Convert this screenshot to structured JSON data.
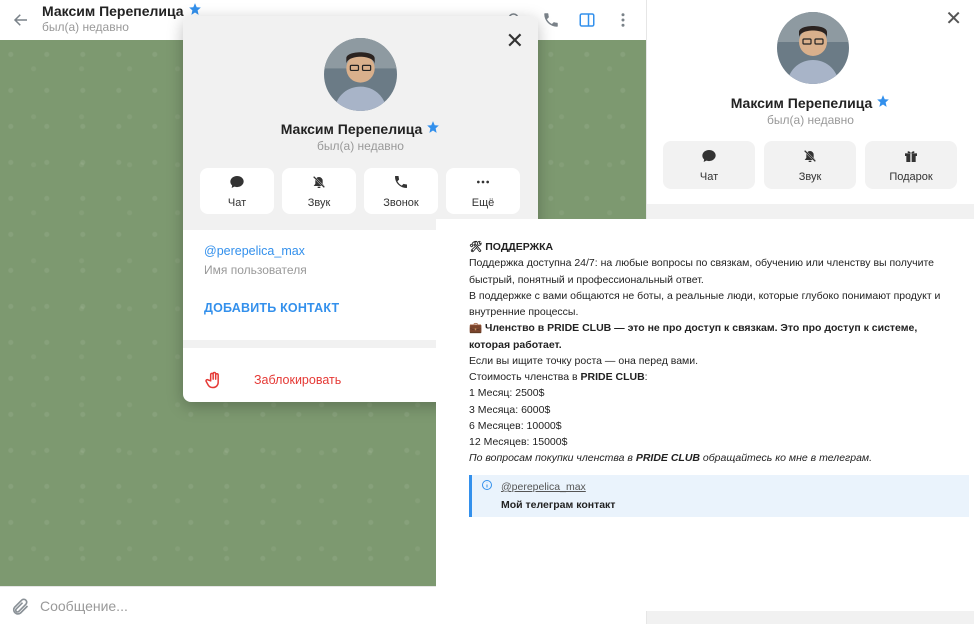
{
  "header": {
    "title": "Максим Перепелица",
    "status": "был(а) недавно"
  },
  "composer": {
    "placeholder": "Сообщение..."
  },
  "popup": {
    "name": "Максим Перепелица",
    "status": "был(а) недавно",
    "actions": [
      {
        "label": "Чат",
        "icon": "chat-icon"
      },
      {
        "label": "Звук",
        "icon": "mute-icon"
      },
      {
        "label": "Звонок",
        "icon": "phone-icon"
      },
      {
        "label": "Ещё",
        "icon": "more-icon"
      }
    ],
    "username": "@perepelica_max",
    "username_caption": "Имя пользователя",
    "add_contact": "ДОБАВИТЬ КОНТАКТ",
    "block": "Заблокировать"
  },
  "right_panel": {
    "name": "Максим Перепелица",
    "status": "был(а) недавно",
    "actions": [
      {
        "label": "Чат",
        "icon": "chat-icon"
      },
      {
        "label": "Звук",
        "icon": "mute-icon"
      },
      {
        "label": "Подарок",
        "icon": "gift-icon"
      }
    ]
  },
  "message": {
    "support_title": "🛠 ПОДДЕРЖКА",
    "support_p1": "Поддержка доступна 24/7: на любые вопросы по связкам, обучению или членству вы получите быстрый, понятный и профессиональный ответ.",
    "support_p2": "В поддержке с вами общаются не боты, а реальные люди, которые глубоко понимают продукт и внутренние процессы.",
    "membership_title": "💼 Членство в PRIDE CLUB — это не про доступ к связкам. Это про доступ к системе, которая работает.",
    "growth": "Если вы ищите точку роста — она перед вами.",
    "cost_label": "Стоимость членства в ",
    "cost_label_bold": "PRIDE CLUB",
    "cost_label_end": ":",
    "prices": [
      "1 Месяц: 2500$",
      "3 Месяца: 6000$",
      "6 Месяцев: 10000$",
      "12 Месяцев: 15000$"
    ],
    "note_start": "По вопросам покупки членства в ",
    "note_bold": "PRIDE CLUB",
    "note_end": " обращайтесь ко мне в телеграм.",
    "quote_link": "@perepelica_max",
    "quote_text": "Мой телеграм контакт"
  },
  "colors": {
    "accent": "#3390ec",
    "danger": "#e53935",
    "verified": "#3390ec",
    "chat_bg": "#7d9970"
  }
}
